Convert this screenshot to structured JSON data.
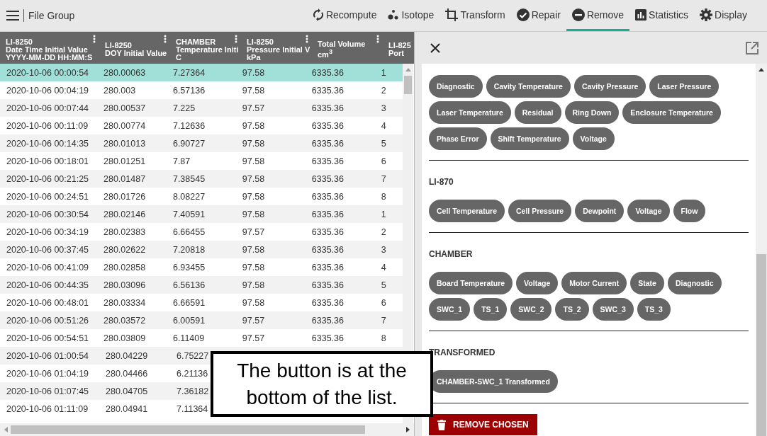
{
  "app_bar": {
    "title": "File Group"
  },
  "toolbar": [
    {
      "label": "Recompute",
      "selected": false
    },
    {
      "label": "Isotope",
      "selected": false
    },
    {
      "label": "Transform",
      "selected": false
    },
    {
      "label": "Repair",
      "selected": false
    },
    {
      "label": "Remove",
      "selected": true
    },
    {
      "label": "Statistics",
      "selected": false
    },
    {
      "label": "Display",
      "selected": false
    }
  ],
  "table": {
    "columns": [
      {
        "lines": [
          "LI-8250",
          "Date Time Initial Value",
          "YYYY-MM-DD HH:MM:S"
        ]
      },
      {
        "lines": [
          "LI-8250",
          "DOY Initial Value"
        ]
      },
      {
        "lines": [
          "CHAMBER",
          "Temperature Initi",
          "C"
        ]
      },
      {
        "lines": [
          "LI-8250",
          "Pressure Initial V",
          "kPa"
        ]
      },
      {
        "lines": [
          "Total Volume",
          "cm$^{3}$"
        ]
      },
      {
        "lines": [
          "LI-825",
          "Port"
        ]
      }
    ],
    "rows": [
      {
        "selected": true,
        "cells": [
          "2020-10-06 00:00:54",
          "280.00063",
          "7.27364",
          "97.58",
          "6335.36",
          "1"
        ]
      },
      {
        "selected": false,
        "cells": [
          "2020-10-06 00:04:19",
          "280.003",
          "6.57136",
          "97.58",
          "6335.36",
          "2"
        ]
      },
      {
        "selected": false,
        "cells": [
          "2020-10-06 00:07:44",
          "280.00537",
          "7.225",
          "97.57",
          "6335.36",
          "3"
        ]
      },
      {
        "selected": false,
        "cells": [
          "2020-10-06 00:11:09",
          "280.00774",
          "7.12636",
          "97.58",
          "6335.36",
          "4"
        ]
      },
      {
        "selected": false,
        "cells": [
          "2020-10-06 00:14:35",
          "280.01013",
          "6.90727",
          "97.58",
          "6335.36",
          "5"
        ]
      },
      {
        "selected": false,
        "cells": [
          "2020-10-06 00:18:01",
          "280.01251",
          "7.87",
          "97.58",
          "6335.36",
          "6"
        ]
      },
      {
        "selected": false,
        "cells": [
          "2020-10-06 00:21:25",
          "280.01487",
          "7.38545",
          "97.58",
          "6335.36",
          "7"
        ]
      },
      {
        "selected": false,
        "cells": [
          "2020-10-06 00:24:51",
          "280.01726",
          "8.08227",
          "97.58",
          "6335.36",
          "8"
        ]
      },
      {
        "selected": false,
        "cells": [
          "2020-10-06 00:30:54",
          "280.02146",
          "7.40591",
          "97.58",
          "6335.36",
          "1"
        ]
      },
      {
        "selected": false,
        "cells": [
          "2020-10-06 00:34:19",
          "280.02383",
          "6.66455",
          "97.57",
          "6335.36",
          "2"
        ]
      },
      {
        "selected": false,
        "cells": [
          "2020-10-06 00:37:45",
          "280.02622",
          "7.20818",
          "97.58",
          "6335.36",
          "3"
        ]
      },
      {
        "selected": false,
        "cells": [
          "2020-10-06 00:41:09",
          "280.02858",
          "6.93455",
          "97.58",
          "6335.36",
          "4"
        ]
      },
      {
        "selected": false,
        "cells": [
          "2020-10-06 00:44:35",
          "280.03096",
          "6.56136",
          "97.58",
          "6335.36",
          "5"
        ]
      },
      {
        "selected": false,
        "cells": [
          "2020-10-06 00:48:01",
          "280.03334",
          "6.66591",
          "97.58",
          "6335.36",
          "6"
        ]
      },
      {
        "selected": false,
        "cells": [
          "2020-10-06 00:51:26",
          "280.03572",
          "6.00591",
          "97.57",
          "6335.36",
          "7"
        ]
      },
      {
        "selected": false,
        "cells": [
          "2020-10-06 00:54:51",
          "280.03809",
          "6.11409",
          "97.57",
          "6335.36",
          "8"
        ]
      },
      {
        "selected": false,
        "cells": [
          "2020-10-06 01:00:54",
          "280.04229",
          "6.75227"
        ]
      },
      {
        "selected": false,
        "cells": [
          "2020-10-06 01:04:19",
          "280.04466",
          "6.21136"
        ]
      },
      {
        "selected": false,
        "cells": [
          "2020-10-06 01:07:45",
          "280.04705",
          "7.36182"
        ]
      },
      {
        "selected": false,
        "cells": [
          "2020-10-06 01:11:09",
          "280.04941",
          "7.11364"
        ]
      }
    ]
  },
  "panel": {
    "sections": [
      {
        "chips": [
          "Diagnostic",
          "Cavity Temperature",
          "Cavity Pressure",
          "Laser Pressure",
          "Laser Temperature",
          "Residual",
          "Ring Down",
          "Enclosure Temperature",
          "Phase Error",
          "Shift Temperature",
          "Voltage"
        ]
      },
      {
        "heading": "LI-870",
        "chips": [
          "Cell Temperature",
          "Cell Pressure",
          "Dewpoint",
          "Voltage",
          "Flow"
        ]
      },
      {
        "heading": "CHAMBER",
        "chips": [
          "Board Temperature",
          "Voltage",
          "Motor Current",
          "State",
          "Diagnostic",
          "SWC_1",
          "TS_1",
          "SWC_2",
          "TS_2",
          "SWC_3",
          "TS_3"
        ]
      },
      {
        "heading": "TRANSFORMED",
        "chips": [
          "CHAMBER-SWC_1 Transformed"
        ]
      }
    ],
    "button": "REMOVE CHOSEN"
  },
  "callout": {
    "text": "The button is at the bottom of the list."
  }
}
